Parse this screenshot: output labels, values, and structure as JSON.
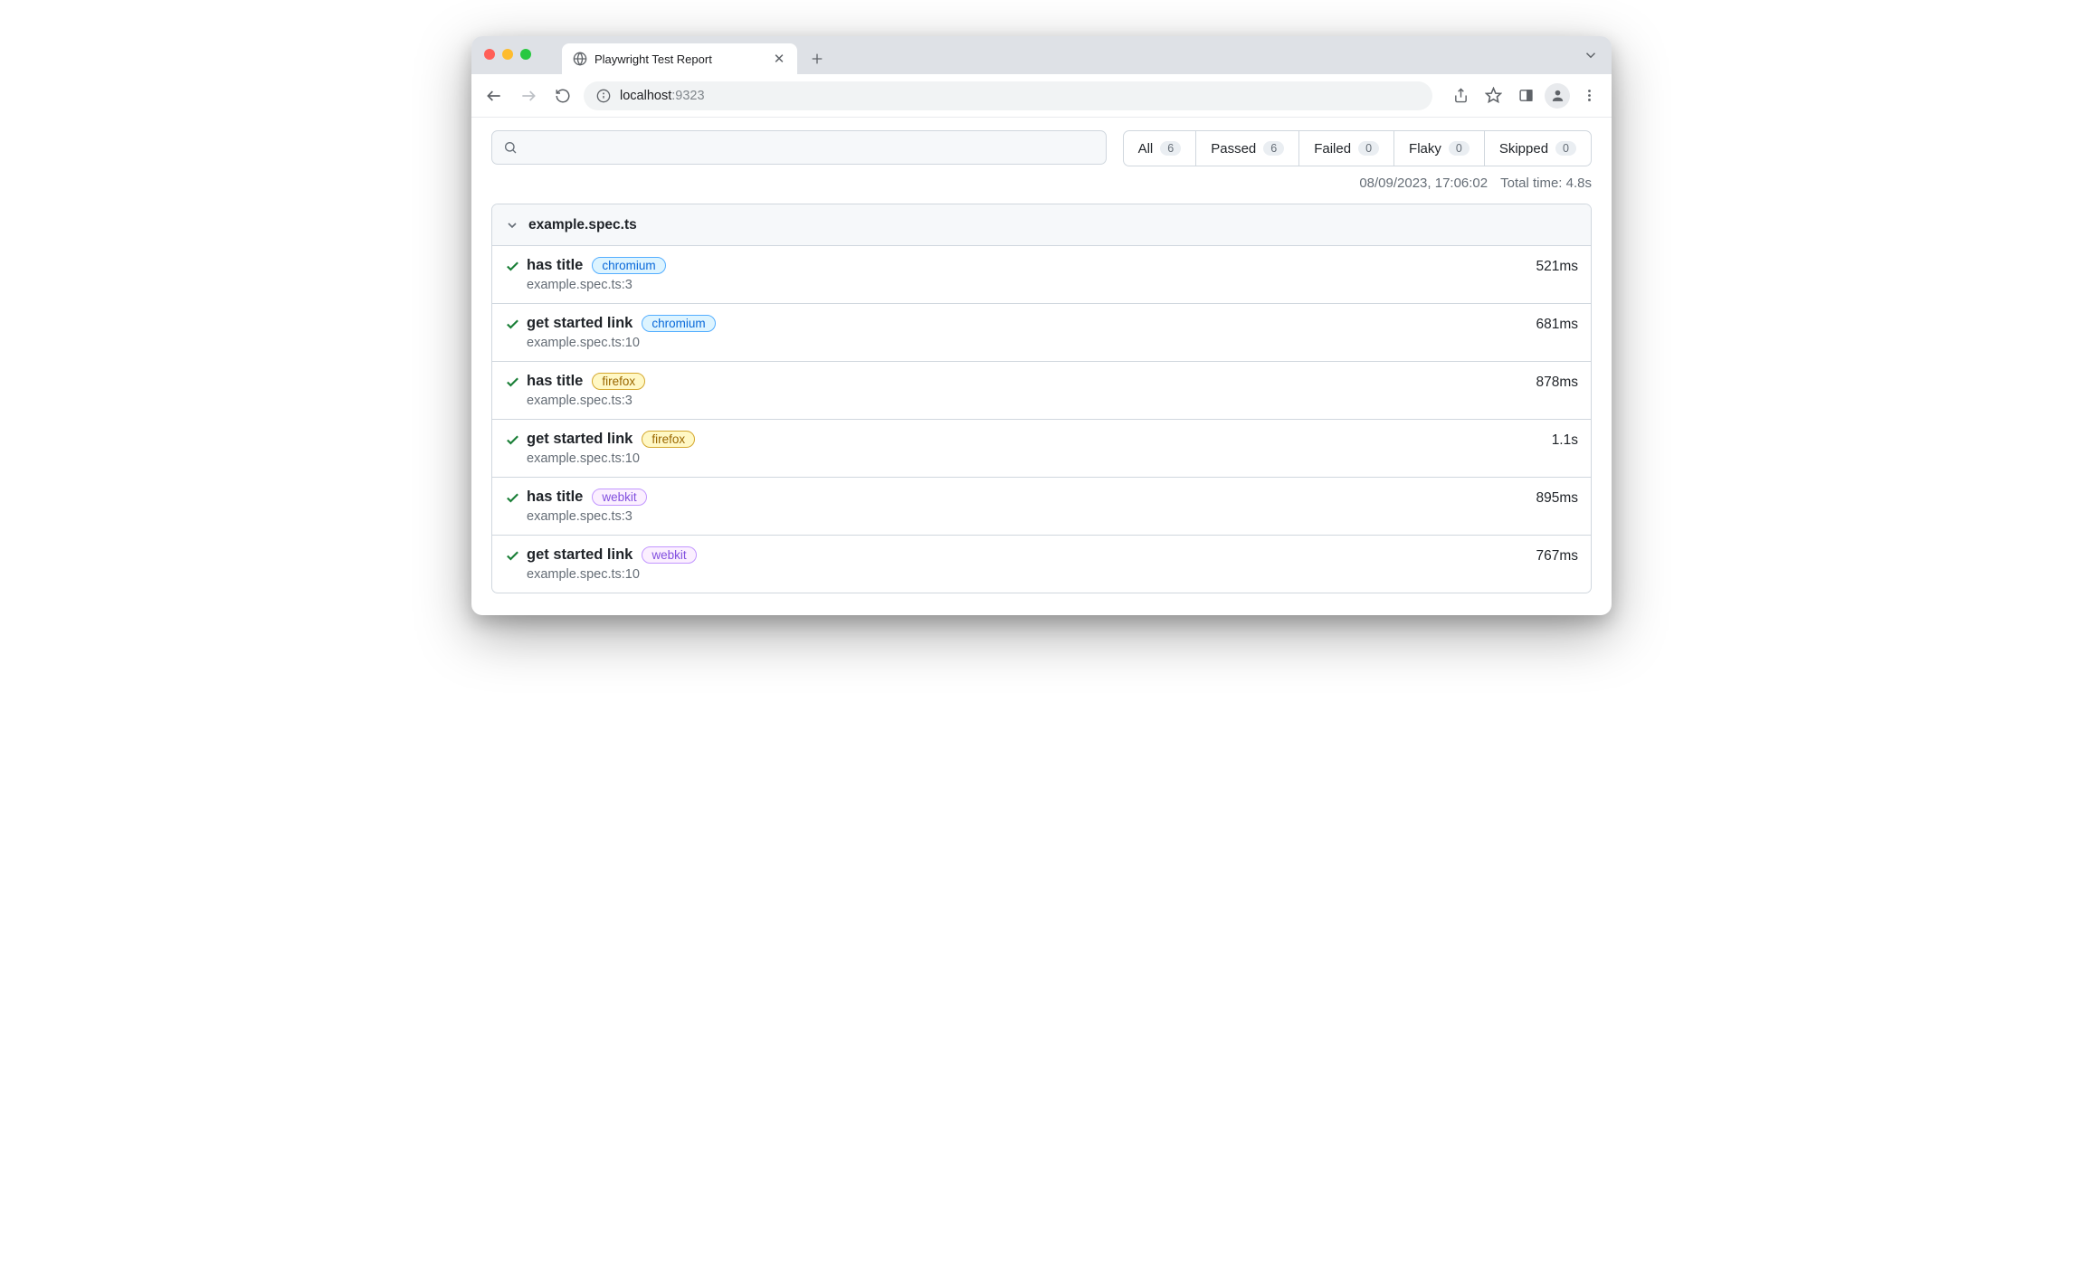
{
  "browser": {
    "tab_title": "Playwright Test Report",
    "url_host": "localhost",
    "url_port": ":9323"
  },
  "search": {
    "placeholder": ""
  },
  "filters": {
    "all": {
      "label": "All",
      "count": "6"
    },
    "passed": {
      "label": "Passed",
      "count": "6"
    },
    "failed": {
      "label": "Failed",
      "count": "0"
    },
    "flaky": {
      "label": "Flaky",
      "count": "0"
    },
    "skipped": {
      "label": "Skipped",
      "count": "0"
    }
  },
  "meta": {
    "timestamp": "08/09/2023, 17:06:02",
    "total_time": "Total time: 4.8s"
  },
  "file": {
    "name": "example.spec.ts"
  },
  "tests": [
    {
      "name": "has title",
      "browser": "chromium",
      "browserClass": "b-chromium",
      "location": "example.spec.ts:3",
      "duration": "521ms"
    },
    {
      "name": "get started link",
      "browser": "chromium",
      "browserClass": "b-chromium",
      "location": "example.spec.ts:10",
      "duration": "681ms"
    },
    {
      "name": "has title",
      "browser": "firefox",
      "browserClass": "b-firefox",
      "location": "example.spec.ts:3",
      "duration": "878ms"
    },
    {
      "name": "get started link",
      "browser": "firefox",
      "browserClass": "b-firefox",
      "location": "example.spec.ts:10",
      "duration": "1.1s"
    },
    {
      "name": "has title",
      "browser": "webkit",
      "browserClass": "b-webkit",
      "location": "example.spec.ts:3",
      "duration": "895ms"
    },
    {
      "name": "get started link",
      "browser": "webkit",
      "browserClass": "b-webkit",
      "location": "example.spec.ts:10",
      "duration": "767ms"
    }
  ]
}
